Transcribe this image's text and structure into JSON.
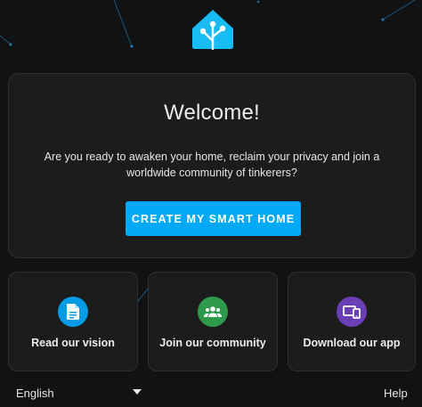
{
  "welcome": {
    "title": "Welcome!",
    "text": "Are you ready to awaken your home, reclaim your privacy and join a worldwide community of tinkerers?",
    "button_label": "CREATE MY SMART HOME"
  },
  "cards": [
    {
      "label": "Read our vision",
      "icon": "document-icon",
      "color": "#039be5"
    },
    {
      "label": "Join our community",
      "icon": "people-group-icon",
      "color": "#2e9a4c"
    },
    {
      "label": "Download our app",
      "icon": "devices-icon",
      "color": "#6a3fb5"
    }
  ],
  "footer": {
    "language": "English",
    "help": "Help"
  },
  "colors": {
    "accent": "#03a9f4",
    "background": "#111213",
    "card": "#1c1c1c"
  }
}
